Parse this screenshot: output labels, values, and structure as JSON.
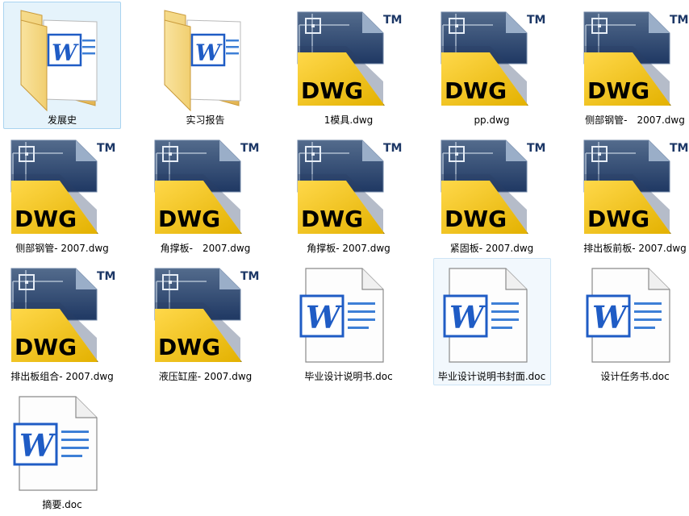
{
  "files": [
    {
      "name": "发展史",
      "type": "folder-doc",
      "state": "selected"
    },
    {
      "name": "实习报告",
      "type": "folder-doc",
      "state": "normal"
    },
    {
      "name": "1模具.dwg",
      "type": "dwg",
      "state": "normal"
    },
    {
      "name": "pp.dwg",
      "type": "dwg",
      "state": "normal"
    },
    {
      "name": "侧部钢管-　2007.dwg",
      "type": "dwg",
      "state": "normal"
    },
    {
      "name": "侧部钢管- 2007.dwg",
      "type": "dwg",
      "state": "normal"
    },
    {
      "name": "角撑板-　2007.dwg",
      "type": "dwg",
      "state": "normal"
    },
    {
      "name": "角撑板- 2007.dwg",
      "type": "dwg",
      "state": "normal"
    },
    {
      "name": "紧固板- 2007.dwg",
      "type": "dwg",
      "state": "normal"
    },
    {
      "name": "排出板前板- 2007.dwg",
      "type": "dwg",
      "state": "normal"
    },
    {
      "name": "排出板组合- 2007.dwg",
      "type": "dwg",
      "state": "normal"
    },
    {
      "name": "液压缸座- 2007.dwg",
      "type": "dwg",
      "state": "normal"
    },
    {
      "name": "毕业设计说明书.doc",
      "type": "doc",
      "state": "normal"
    },
    {
      "name": "毕业设计说明书封面.doc",
      "type": "doc",
      "state": "hover"
    },
    {
      "name": "设计任务书.doc",
      "type": "doc",
      "state": "normal"
    },
    {
      "name": "摘要.doc",
      "type": "doc",
      "state": "normal"
    }
  ],
  "dwg_icon": {
    "badge": "DWG",
    "tm": "TM"
  },
  "colors": {
    "selected_bg": "#e5f3fb",
    "selected_border": "#a9d3f0",
    "word_blue": "#1f5cc5",
    "dwg_yellow": "#f2c500",
    "dwg_navy": "#1e3a6d"
  }
}
